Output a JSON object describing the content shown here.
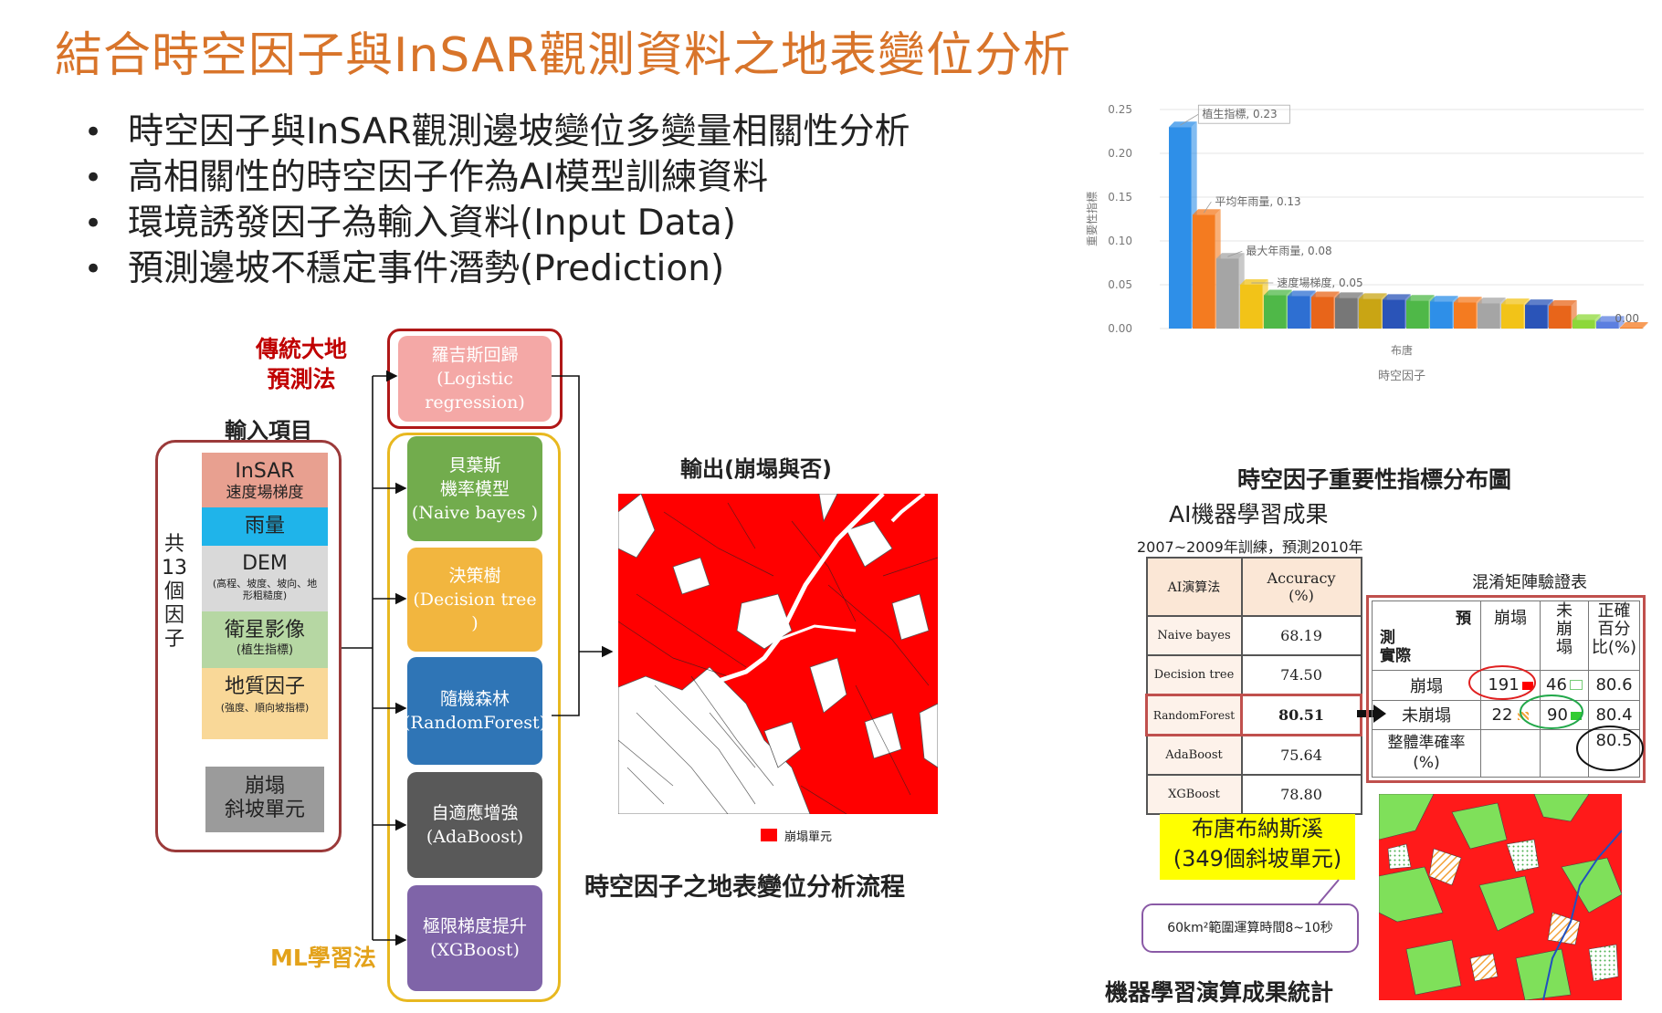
{
  "title": "結合時空因子與InSAR觀測資料之地表變位分析",
  "bullets": [
    "時空因子與InSAR觀測邊坡變位多變量相關性分析",
    "高相關性的時空因子作為AI模型訓練資料",
    "環境誘發因子為輸入資料(Input Data)",
    "預測邊坡不穩定事件潛勢(Prediction)"
  ],
  "flow": {
    "traditional_label": "傳統大地\n預測法",
    "input_label": "輸入項目",
    "factor_count_label": "共\n13\n個\n因\n子",
    "ml_label": "ML學習法",
    "output_label": "輸出(崩塌與否)",
    "caption": "時空因子之地表變位分析流程",
    "legend": "崩塌單元",
    "inputs": [
      {
        "name": "InSAR",
        "sub": "速度場梯度",
        "color": "#e8a090"
      },
      {
        "name": "雨量",
        "sub": "",
        "color": "#1fb4ea"
      },
      {
        "name": "DEM",
        "sub": "(高程、坡度、坡向、地形粗糙度)",
        "color": "#d9d9d9"
      },
      {
        "name": "衛星影像",
        "sub": "(植生指標)",
        "color": "#b6d7a3"
      },
      {
        "name": "地質因子",
        "sub": "(強度、順向坡指標)",
        "color": "#f9d898"
      },
      {
        "name": "崩塌\n斜坡單元",
        "sub": "",
        "color": "#9b9b9b"
      }
    ],
    "logistic": {
      "name": "羅吉斯回歸",
      "en": "(Logistic\nregression)",
      "color": "#f4a8a6"
    },
    "models": [
      {
        "name": "貝葉斯\n機率模型",
        "en": "(Naive bayes )",
        "color": "#72ac4d"
      },
      {
        "name": "決策樹",
        "en": "(Decision tree )",
        "color": "#f2b63f"
      },
      {
        "name": "隨機森林",
        "en": "(RandomForest)",
        "color": "#2f75b6"
      },
      {
        "name": "自適應增強",
        "en": "(AdaBoost)",
        "color": "#595959"
      },
      {
        "name": "極限梯度提升",
        "en": "(XGBoost)",
        "color": "#7f64a8"
      }
    ]
  },
  "chart_data": {
    "type": "bar",
    "title": "時空因子重要性指標分布圖",
    "xlabel": "時空因子",
    "x_category_label": "布唐",
    "ylabel": "重要性指標",
    "ylim": [
      0,
      0.25
    ],
    "yticks": [
      "0.00",
      "0.05",
      "0.10",
      "0.15",
      "0.20",
      "0.25"
    ],
    "values": [
      0.23,
      0.13,
      0.08,
      0.05,
      0.038,
      0.037,
      0.036,
      0.035,
      0.034,
      0.033,
      0.032,
      0.031,
      0.03,
      0.029,
      0.028,
      0.027,
      0.026,
      0.01,
      0.008,
      0.001
    ],
    "colors": [
      "#2e8fe8",
      "#f47b20",
      "#a5a5a5",
      "#f2c318",
      "#4fb848",
      "#2e6fd2",
      "#e8651a",
      "#777777",
      "#c9a514",
      "#2a54b8",
      "#4fb848",
      "#2e8fe8",
      "#f47b20",
      "#a5a5a5",
      "#f2c318",
      "#2a54b8",
      "#e8651a",
      "#8dd83a",
      "#5b7fe0",
      "#f47b20"
    ],
    "annotations": [
      {
        "index": 0,
        "text": "植生指標, 0.23"
      },
      {
        "index": 1,
        "text": "平均年雨量, 0.13"
      },
      {
        "index": 2,
        "text": "最大年雨量, 0.08"
      },
      {
        "index": 3,
        "text": "速度場梯度, 0.05"
      },
      {
        "index": 19,
        "text": "0.00"
      }
    ]
  },
  "ml": {
    "heading": "AI機器學習成果",
    "subheading": "2007~2009年訓練，預測2010年",
    "table_headers": [
      "AI演算法",
      "Accuracy\n(%)"
    ],
    "rows": [
      {
        "algo": "Naive bayes",
        "acc": "68.19"
      },
      {
        "algo": "Decision tree",
        "acc": "74.50"
      },
      {
        "algo": "RandomForest",
        "acc": "80.51"
      },
      {
        "algo": "AdaBoost",
        "acc": "75.64"
      },
      {
        "algo": "XGBoost",
        "acc": "78.80"
      }
    ],
    "site_label": "布唐布納斯溪\n(349個斜坡單元)",
    "compute_note": "60km²範圍運算時間8~10秒",
    "footer": "機器學習演算成果統計",
    "cm_title": "混淆矩陣驗證表",
    "cm": {
      "corner_top": "預",
      "corner_bottom": "測\n實際",
      "col1": "崩塌",
      "col2": "未\n崩\n塌",
      "col3": "正確\n百分\n比(%)",
      "r1_label": "崩塌",
      "r1_a": "191",
      "r1_b": "46",
      "r1_c": "80.6",
      "r2_label": "未崩塌",
      "r2_a": "22",
      "r2_b": "90",
      "r2_c": "80.4",
      "r3_label": "整體準確率\n(%)",
      "r3_c": "80.5"
    }
  }
}
